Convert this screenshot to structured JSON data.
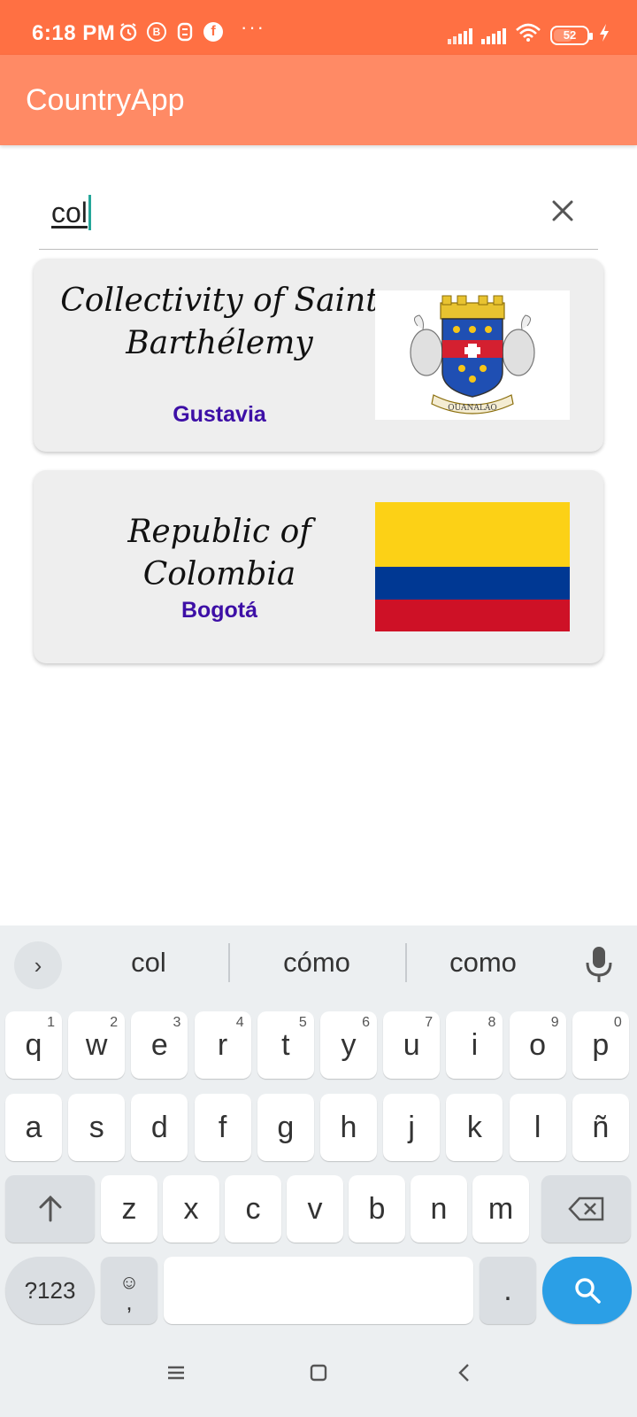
{
  "status_bar": {
    "time": "6:18 PM",
    "battery": "52",
    "icons": [
      "alarm-icon",
      "b-app-icon",
      "s-app-icon",
      "facebook-icon",
      "more-dots-icon",
      "signal-1-icon",
      "signal-2-icon",
      "wifi-icon",
      "battery-icon",
      "charging-icon"
    ],
    "more": "···"
  },
  "app_bar": {
    "title": "CountryApp"
  },
  "search": {
    "value": "col",
    "clear_icon": "close-icon"
  },
  "results": [
    {
      "name_line1": "Collectivity of Saint",
      "name_line2": "Barthélemy",
      "capital": "Gustavia",
      "flag_icon": "saint-barthelemy-coat-of-arms",
      "motto": "OUANALAO"
    },
    {
      "name": "Republic of Colombia",
      "capital": "Bogotá",
      "flag_icon": "colombia-flag",
      "flag_colors": [
        "#fcd116",
        "#003893",
        "#ce1126"
      ]
    }
  ],
  "keyboard": {
    "suggestions": [
      "col",
      "cómo",
      "como"
    ],
    "expand": "›",
    "row1": [
      {
        "k": "q",
        "n": "1"
      },
      {
        "k": "w",
        "n": "2"
      },
      {
        "k": "e",
        "n": "3"
      },
      {
        "k": "r",
        "n": "4"
      },
      {
        "k": "t",
        "n": "5"
      },
      {
        "k": "y",
        "n": "6"
      },
      {
        "k": "u",
        "n": "7"
      },
      {
        "k": "i",
        "n": "8"
      },
      {
        "k": "o",
        "n": "9"
      },
      {
        "k": "p",
        "n": "0"
      }
    ],
    "row2": [
      "a",
      "s",
      "d",
      "f",
      "g",
      "h",
      "j",
      "k",
      "l",
      "ñ"
    ],
    "row3": [
      "z",
      "x",
      "c",
      "v",
      "b",
      "n",
      "m"
    ],
    "symbols_label": "?123",
    "comma": ",",
    "emoji": "☺",
    "period": ".",
    "accent_color": "#2b9fe6"
  },
  "colors": {
    "status_bar": "#ff7043",
    "app_bar": "#ff8a65",
    "capital_text": "#3d0fa6",
    "card_bg": "#eeeeee"
  }
}
